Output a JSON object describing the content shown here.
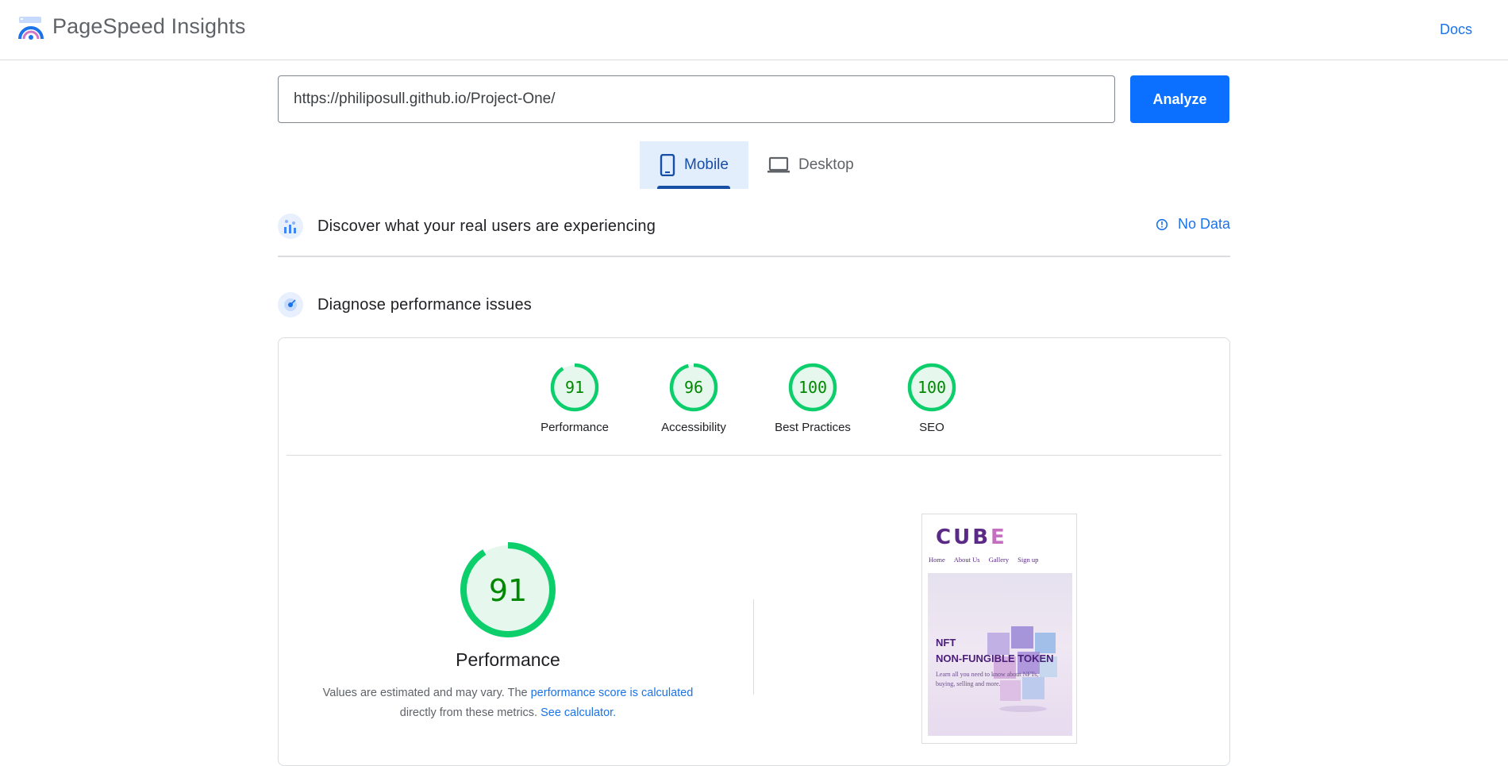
{
  "header": {
    "brand": "PageSpeed Insights",
    "docs_label": "Docs"
  },
  "search": {
    "url_value": "https://philiposull.github.io/Project-One/",
    "analyze_label": "Analyze"
  },
  "tabs": [
    {
      "label": "Mobile",
      "selected": true
    },
    {
      "label": "Desktop",
      "selected": false
    }
  ],
  "real_users": {
    "title": "Discover what your real users are experiencing",
    "status": "No Data"
  },
  "diagnose": {
    "title": "Diagnose performance issues"
  },
  "scores": [
    {
      "value": "91",
      "label": "Performance"
    },
    {
      "value": "96",
      "label": "Accessibility"
    },
    {
      "value": "100",
      "label": "Best Practices"
    },
    {
      "value": "100",
      "label": "SEO"
    }
  ],
  "performance": {
    "score": "91",
    "title": "Performance",
    "desc_1": "Values are estimated and may vary. The",
    "link_1": "performance score is calculated",
    "desc_2": "directly from these metrics.",
    "link_2": "See calculator."
  },
  "screenshot": {
    "logo_cub": "CUB",
    "logo_e": "E",
    "nav": [
      "Home",
      "About Us",
      "Gallery",
      "Sign up"
    ],
    "heading_1": "NFT",
    "heading_2": "NON-FUNGIBLE TOKEN",
    "body": "Learn all you need to know about NFTs, buying, selling and more."
  },
  "colors": {
    "accent": "#1a73e8",
    "button": "#0b70ff",
    "pass": "#0cce6b",
    "pass_text": "#008800",
    "pass_fill": "#e6f8ee"
  }
}
